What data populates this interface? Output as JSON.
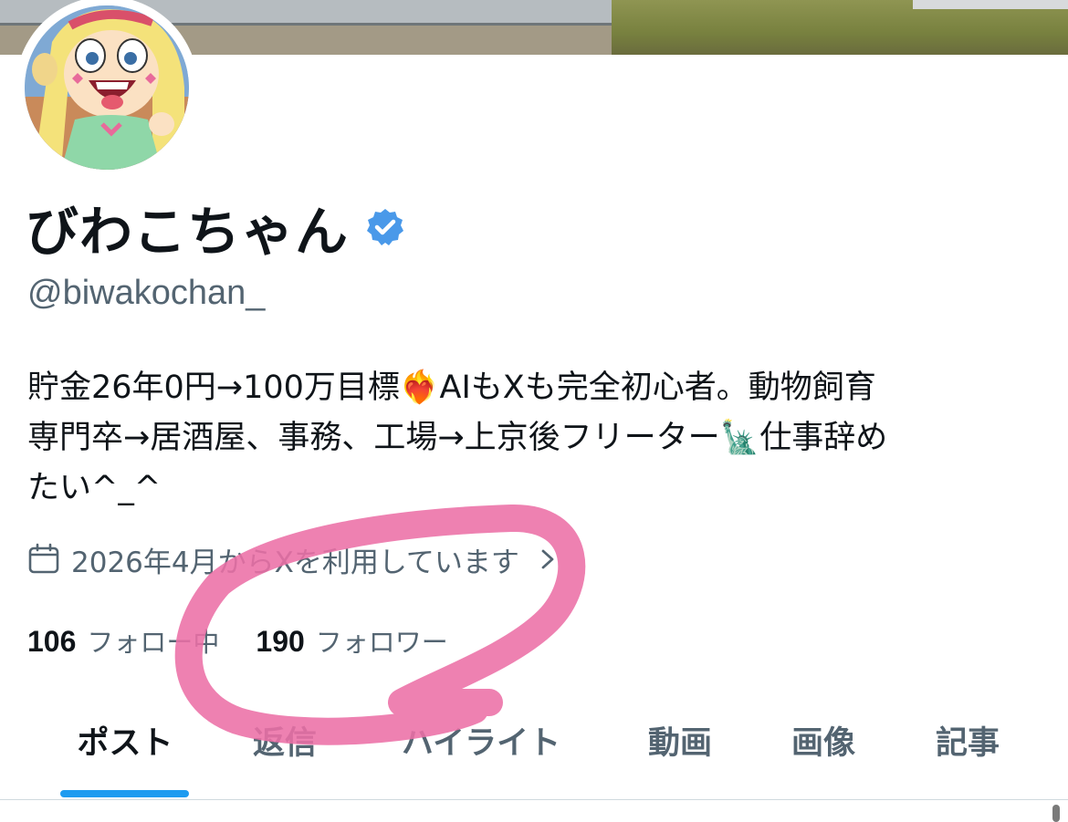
{
  "profile": {
    "display_name": "びわこちゃん",
    "handle": "@biwakochan_",
    "bio_line1": "貯金26年0円→100万目標❤️‍🔥AIもXも完全初心者。動物飼育",
    "bio_line2": "専門卒→居酒屋、事務、工場→上京後フリーター🗽仕事辞め",
    "bio_line3": "たい^_^",
    "joined": "2026年4月からXを利用しています"
  },
  "stats": {
    "following_count": "106",
    "following_label": "フォロー中",
    "followers_count": "190",
    "followers_label": "フォロワー"
  },
  "tabs": [
    {
      "label": "ポスト",
      "active": true
    },
    {
      "label": "返信",
      "active": false
    },
    {
      "label": "ハイライト",
      "active": false
    },
    {
      "label": "動画",
      "active": false
    },
    {
      "label": "画像",
      "active": false
    },
    {
      "label": "記事",
      "active": false
    }
  ],
  "icons": {
    "verified": "verified-badge-icon",
    "calendar": "calendar-icon",
    "chevron": "chevron-right-icon"
  },
  "colors": {
    "accent": "#1d9bf0",
    "verified": "#4a99e9",
    "annotation": "#ec6fa6",
    "secondary_text": "#536471"
  }
}
